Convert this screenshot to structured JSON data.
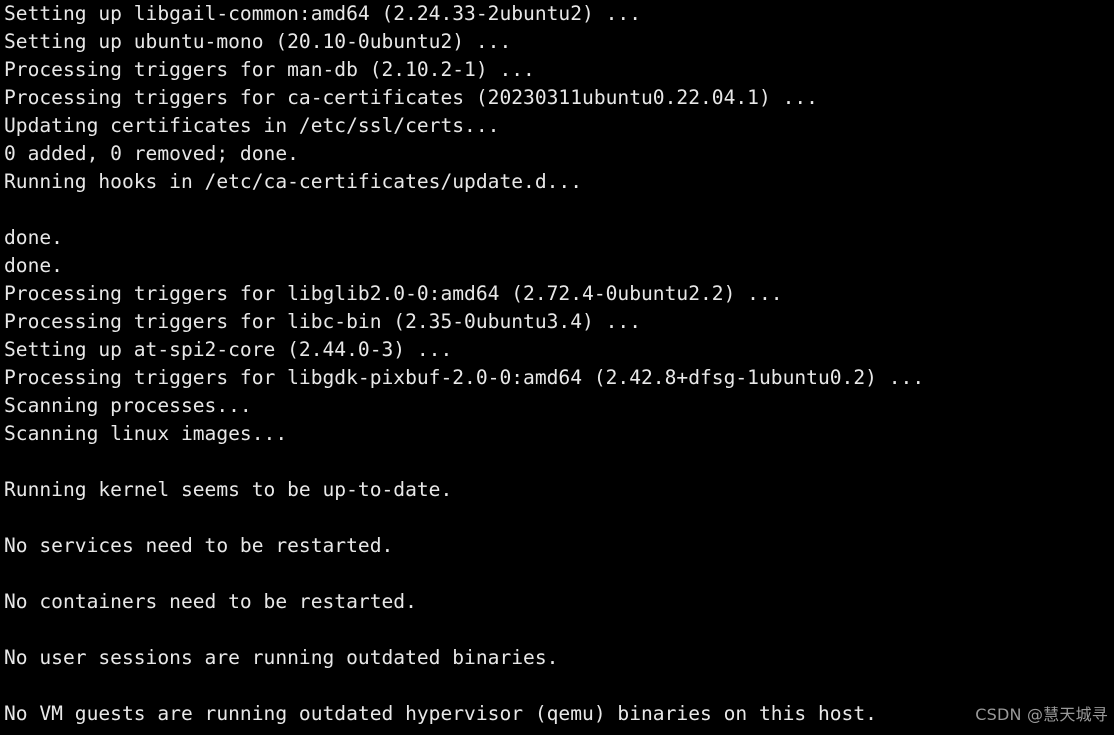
{
  "terminal": {
    "background_color": "#000000",
    "foreground_color": "#e8e8e8",
    "lines": [
      "Setting up libgail-common:amd64 (2.24.33-2ubuntu2) ...",
      "Setting up ubuntu-mono (20.10-0ubuntu2) ...",
      "Processing triggers for man-db (2.10.2-1) ...",
      "Processing triggers for ca-certificates (20230311ubuntu0.22.04.1) ...",
      "Updating certificates in /etc/ssl/certs...",
      "0 added, 0 removed; done.",
      "Running hooks in /etc/ca-certificates/update.d...",
      "",
      "done.",
      "done.",
      "Processing triggers for libglib2.0-0:amd64 (2.72.4-0ubuntu2.2) ...",
      "Processing triggers for libc-bin (2.35-0ubuntu3.4) ...",
      "Setting up at-spi2-core (2.44.0-3) ...",
      "Processing triggers for libgdk-pixbuf-2.0-0:amd64 (2.42.8+dfsg-1ubuntu0.2) ...",
      "Scanning processes...",
      "Scanning linux images...",
      "",
      "Running kernel seems to be up-to-date.",
      "",
      "No services need to be restarted.",
      "",
      "No containers need to be restarted.",
      "",
      "No user sessions are running outdated binaries.",
      "",
      "No VM guests are running outdated hypervisor (qemu) binaries on this host."
    ]
  },
  "watermark": {
    "text": "CSDN @慧天城寻",
    "color": "#9a9a9a"
  }
}
